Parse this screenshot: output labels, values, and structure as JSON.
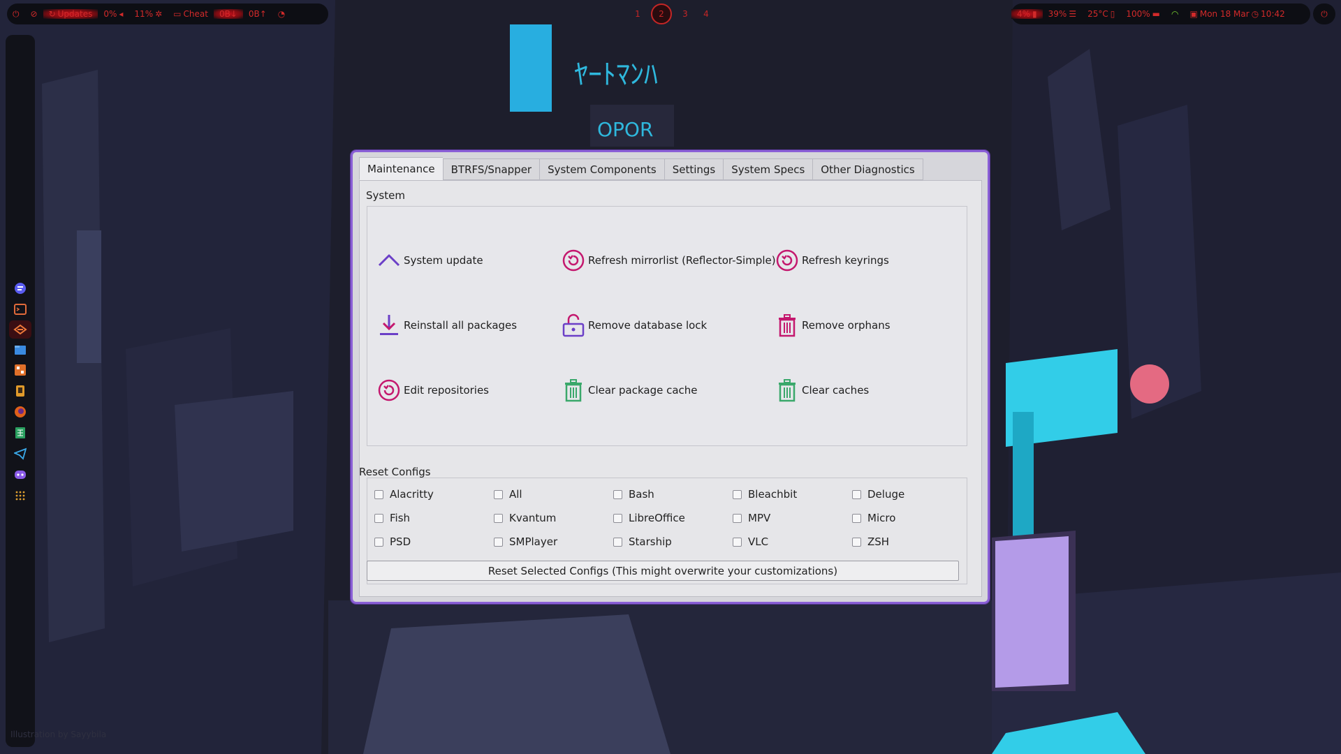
{
  "topbar": {
    "left": {
      "updates": "Updates",
      "volume": "0%",
      "cpu": "11%",
      "cheat": "Cheat",
      "net_down": "0B↓",
      "net_up": "0B↑"
    },
    "workspaces": [
      "1",
      "2",
      "3",
      "4"
    ],
    "active_workspace": "2",
    "right": {
      "brightness": "4%",
      "memory": "39%",
      "temperature": "25°C",
      "battery": "100%",
      "date": "Mon 18 Mar",
      "time": "10:42"
    }
  },
  "dock": {
    "items": [
      "app-launcher-icon",
      "terminal-icon",
      "garuda-assistant-icon",
      "file-manager-icon",
      "boot-options-icon",
      "phone-icon",
      "firefox-icon",
      "sheets-icon",
      "telegram-icon",
      "discord-icon",
      "app-grid-icon"
    ]
  },
  "credit": "Illustration by Sayybila",
  "window": {
    "tabs": [
      "Maintenance",
      "BTRFS/Snapper",
      "System Components",
      "Settings",
      "System Specs",
      "Other Diagnostics"
    ],
    "active_tab": "Maintenance",
    "system": {
      "title": "System",
      "actions": [
        {
          "label": "System update",
          "icon": "arrow-up-icon"
        },
        {
          "label": "Refresh mirrorlist (Reflector-Simple)",
          "icon": "refresh-icon"
        },
        {
          "label": "Refresh keyrings",
          "icon": "refresh-icon"
        },
        {
          "label": "Reinstall all packages",
          "icon": "download-icon"
        },
        {
          "label": "Remove database lock",
          "icon": "unlock-icon"
        },
        {
          "label": "Remove orphans",
          "icon": "trash-icon"
        },
        {
          "label": "Edit repositories",
          "icon": "refresh-icon"
        },
        {
          "label": "Clear package cache",
          "icon": "trash-icon"
        },
        {
          "label": "Clear caches",
          "icon": "trash-icon"
        }
      ]
    },
    "reset_configs": {
      "title": "Reset Configs",
      "checkboxes": [
        "Alacritty",
        "All",
        "Bash",
        "Bleachbit",
        "Deluge",
        "Fish",
        "Kvantum",
        "LibreOffice",
        "MPV",
        "Micro",
        "PSD",
        "SMPlayer",
        "Starship",
        "VLC",
        "ZSH"
      ],
      "button": "Reset Selected Configs (This might overwrite your customizations)"
    }
  },
  "colors": {
    "accent_purple": "#8a5fd6",
    "icon_magenta": "#c4186e",
    "icon_green": "#3aa86b",
    "bar_red": "#d22a2a"
  }
}
